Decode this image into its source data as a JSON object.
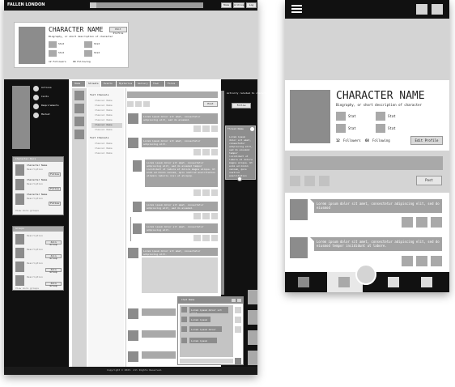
{
  "desktop": {
    "brand": "FALLEN LONDON",
    "nav": [
      "Home",
      "Archive",
      "Log Out"
    ],
    "profile": {
      "name": "CHARACTER NAME",
      "bio": "Biography, or short description of character",
      "edit_label": "Edit Profile",
      "stats": [
        "Stat",
        "Stat",
        "Stat",
        "Stat"
      ],
      "followers": "12 Followers",
      "following": "68 Following"
    },
    "sidebar_menu": [
      "Actions",
      "Cards",
      "Requirements",
      "Market"
    ],
    "suggest_box": {
      "title": "Character Recs",
      "items": [
        {
          "name": "Character Name",
          "desc": "Description",
          "btn": "Follow"
        },
        {
          "name": "Character Name",
          "desc": "Description",
          "btn": "Follow"
        },
        {
          "name": "Character Name",
          "desc": "Description",
          "btn": "Follow"
        }
      ],
      "more": "View more groups"
    },
    "group_box": {
      "title": "Groups",
      "items": [
        {
          "desc": "Description",
          "btn": "Join Group"
        },
        {
          "desc": "Description",
          "btn": "Join Group"
        },
        {
          "desc": "Description",
          "btn": "Join Group"
        },
        {
          "desc": "Description",
          "btn": "Join Group"
        }
      ],
      "more": "View more groups"
    },
    "tabs": [
      "Home",
      "Streets",
      "Events",
      "Mysteries",
      "Gallery",
      "Town",
      "Forum"
    ],
    "channels": {
      "text_header": "Text Channels",
      "text_items": [
        "Channel Name",
        "Channel Name",
        "Channel Name",
        "Channel Name",
        "Channel Name",
        "Channel Name",
        "Channel Name"
      ],
      "voice_header": "Text Channels",
      "voice_items": [
        "Channel Name",
        "Channel Name",
        "Channel Name"
      ]
    },
    "post_label": "Post",
    "feed_posts": [
      "Lorem ipsum dolor sit amet, consectetur adipiscing elit, sed do eiusmod.",
      "Lorem ipsum dolor sit amet, consectetur adipiscing elit.",
      "Lorem ipsum dolor sit amet, consectetur adipiscing elit, sed do eiusmod tempor incididunt ut labore et dolore magna aliqua. Ut enim ad minim veniam, quis nostrud exercitation ullamco laboris nisi ut aliquip.",
      "Lorem ipsum dolor sit amet, consectetur adipiscing elit, sed do eiusmod.",
      "Lorem ipsum dolor sit amet, consectetur adipiscing elit.",
      "Lorem ipsum dolor sit amet, consectetur adipiscing elit."
    ],
    "notice": "Activity related to character",
    "follow_label": "Follow",
    "thread_title": "Thread Name",
    "thread_text": "Lorem ipsum dolor sit amet, consectetur adipiscing elit, sed do eiusmod tempor incididunt ut labore et dolore magna aliqua. Ut enim ad minim veniam, quis nostrud exercitation ullamco laboris nisi ut aliquip ex ea commodo consequat. Duis aute irure dolor in reprehenderit.",
    "chat_title": "Chat Name",
    "chat_lines": [
      "Lorem ipsum dolor sit amet",
      "Lorem ipsum",
      "Lorem ipsum dolor sit",
      "Lorem ipsum dolor"
    ],
    "footer": "Copyright © 2023. All Rights Reserved."
  },
  "mobile": {
    "name": "CHARACTER NAME",
    "bio": "Biography, or short description of character",
    "stats": [
      "Stat",
      "Stat",
      "Stat",
      "Stat"
    ],
    "followers_count": "12",
    "followers_label": "Followers",
    "following_count": "68",
    "following_label": "Following",
    "edit_label": "Edit Profile",
    "post_label": "Post",
    "posts": [
      "Lorem ipsum dolor sit amet, consectetur adipiscing elit, sed do eiusmod",
      "Lorem ipsum dolor sit amet, consectetur adipiscing elit, sed do eiusmod tempor incididunt ut labore."
    ]
  }
}
